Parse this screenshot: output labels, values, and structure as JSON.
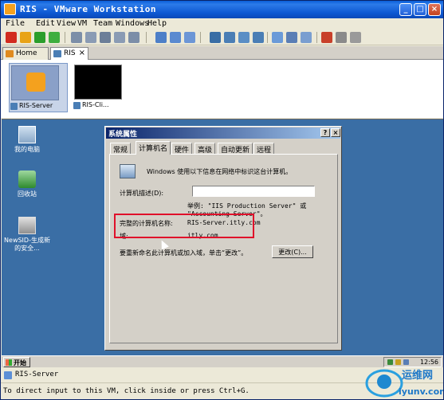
{
  "window": {
    "title": "RIS - VMware Workstation"
  },
  "menu": [
    "File",
    "Edit",
    "View",
    "VM",
    "Team",
    "Windows",
    "Help"
  ],
  "tabs": [
    {
      "label": "Home"
    },
    {
      "label": "RIS"
    }
  ],
  "thumbnails": [
    {
      "label": "RIS-Server"
    },
    {
      "label": "RIS-Cli..."
    }
  ],
  "guest": {
    "desktop_icons": [
      {
        "label": "我的电脑"
      },
      {
        "label": "回收站"
      },
      {
        "label": "NewSID-生成新的安全..."
      }
    ],
    "dialog": {
      "title": "系统属性",
      "tabs": [
        "常规",
        "计算机名",
        "硬件",
        "高级",
        "自动更新",
        "远程"
      ],
      "active_tab": "计算机名",
      "intro": "Windows 使用以下信息在网络中标识这台计算机。",
      "desc_label": "计算机描述(D):",
      "desc_value": "",
      "example": "举例: \"IIS Production Server\" 或",
      "example2": "\"Accounting Server\"。",
      "fullname_label": "完整的计算机名称:",
      "fullname_value": "RIS-Server.itly.com",
      "domain_label": "域:",
      "domain_value": "itly.com",
      "rename_text": "要重新命名此计算机或加入域，单击“更改”。",
      "change_button": "更改(C)..."
    },
    "taskbar": {
      "start": "开始",
      "clock": "12:56"
    }
  },
  "vm_status": {
    "label": "RIS-Server"
  },
  "statusbar": {
    "text": "To direct input to this VM, click inside or press Ctrl+G."
  },
  "watermark": {
    "text": "运维网",
    "url": "iyunv.com"
  }
}
